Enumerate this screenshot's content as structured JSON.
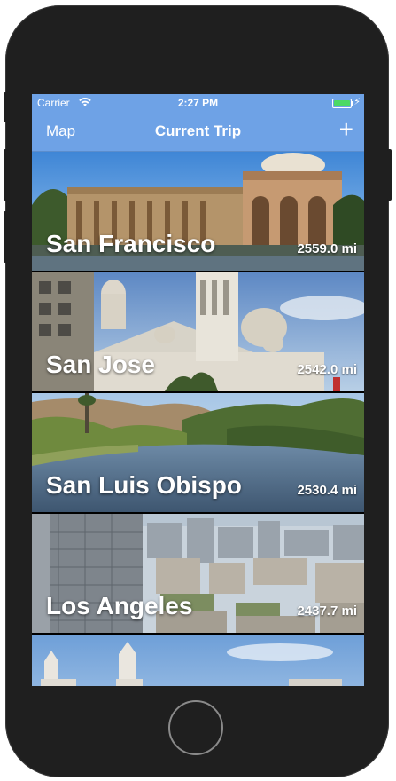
{
  "status_bar": {
    "carrier": "Carrier",
    "time": "2:27 PM",
    "icons": [
      "wifi-icon",
      "battery-icon",
      "charging-bolt-icon"
    ],
    "battery_color": "#4cd964"
  },
  "nav_bar": {
    "left_label": "Map",
    "title": "Current Trip",
    "add_icon": "+",
    "background": "#6ea2e6"
  },
  "trips": [
    {
      "city": "San Francisco",
      "distance": "2559.0 mi"
    },
    {
      "city": "San Jose",
      "distance": "2542.0 mi"
    },
    {
      "city": "San Luis Obispo",
      "distance": "2530.4 mi"
    },
    {
      "city": "Los Angeles",
      "distance": "2437.7 mi"
    },
    {
      "city": "",
      "distance": ""
    }
  ]
}
